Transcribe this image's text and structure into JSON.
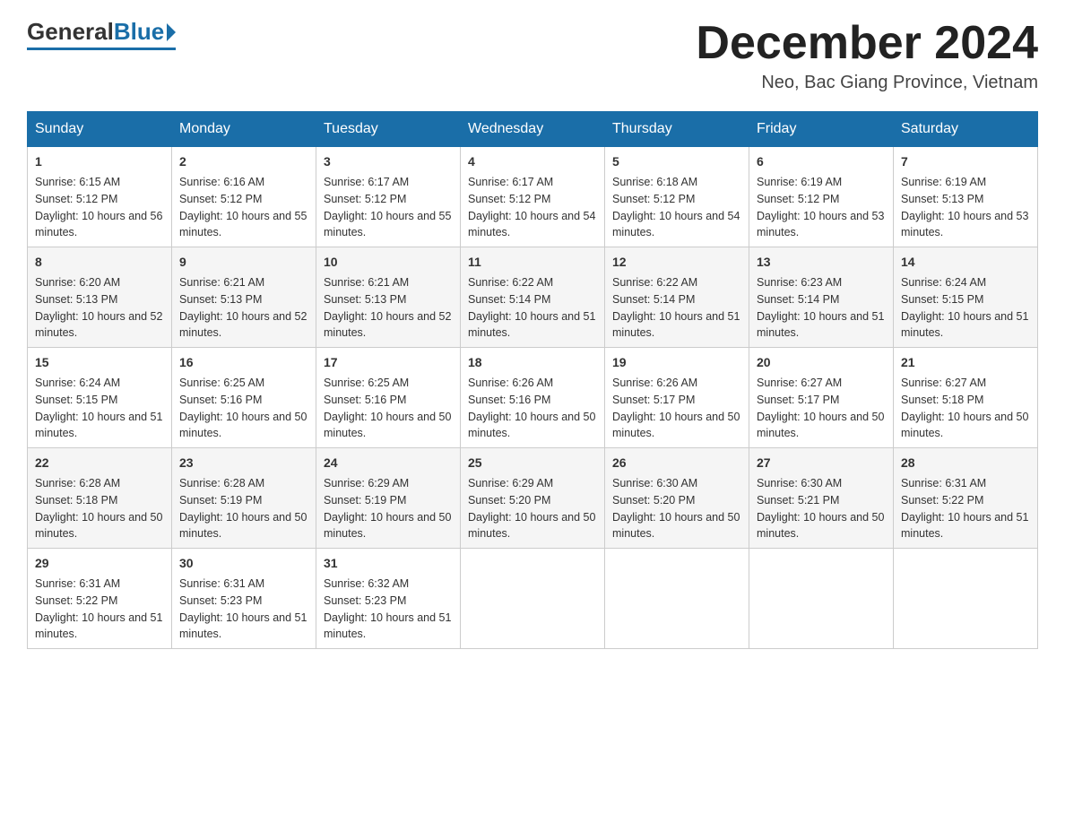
{
  "logo": {
    "general": "General",
    "blue": "Blue"
  },
  "title": {
    "month_year": "December 2024",
    "location": "Neo, Bac Giang Province, Vietnam"
  },
  "headers": [
    "Sunday",
    "Monday",
    "Tuesday",
    "Wednesday",
    "Thursday",
    "Friday",
    "Saturday"
  ],
  "weeks": [
    [
      {
        "day": "1",
        "sunrise": "Sunrise: 6:15 AM",
        "sunset": "Sunset: 5:12 PM",
        "daylight": "Daylight: 10 hours and 56 minutes."
      },
      {
        "day": "2",
        "sunrise": "Sunrise: 6:16 AM",
        "sunset": "Sunset: 5:12 PM",
        "daylight": "Daylight: 10 hours and 55 minutes."
      },
      {
        "day": "3",
        "sunrise": "Sunrise: 6:17 AM",
        "sunset": "Sunset: 5:12 PM",
        "daylight": "Daylight: 10 hours and 55 minutes."
      },
      {
        "day": "4",
        "sunrise": "Sunrise: 6:17 AM",
        "sunset": "Sunset: 5:12 PM",
        "daylight": "Daylight: 10 hours and 54 minutes."
      },
      {
        "day": "5",
        "sunrise": "Sunrise: 6:18 AM",
        "sunset": "Sunset: 5:12 PM",
        "daylight": "Daylight: 10 hours and 54 minutes."
      },
      {
        "day": "6",
        "sunrise": "Sunrise: 6:19 AM",
        "sunset": "Sunset: 5:12 PM",
        "daylight": "Daylight: 10 hours and 53 minutes."
      },
      {
        "day": "7",
        "sunrise": "Sunrise: 6:19 AM",
        "sunset": "Sunset: 5:13 PM",
        "daylight": "Daylight: 10 hours and 53 minutes."
      }
    ],
    [
      {
        "day": "8",
        "sunrise": "Sunrise: 6:20 AM",
        "sunset": "Sunset: 5:13 PM",
        "daylight": "Daylight: 10 hours and 52 minutes."
      },
      {
        "day": "9",
        "sunrise": "Sunrise: 6:21 AM",
        "sunset": "Sunset: 5:13 PM",
        "daylight": "Daylight: 10 hours and 52 minutes."
      },
      {
        "day": "10",
        "sunrise": "Sunrise: 6:21 AM",
        "sunset": "Sunset: 5:13 PM",
        "daylight": "Daylight: 10 hours and 52 minutes."
      },
      {
        "day": "11",
        "sunrise": "Sunrise: 6:22 AM",
        "sunset": "Sunset: 5:14 PM",
        "daylight": "Daylight: 10 hours and 51 minutes."
      },
      {
        "day": "12",
        "sunrise": "Sunrise: 6:22 AM",
        "sunset": "Sunset: 5:14 PM",
        "daylight": "Daylight: 10 hours and 51 minutes."
      },
      {
        "day": "13",
        "sunrise": "Sunrise: 6:23 AM",
        "sunset": "Sunset: 5:14 PM",
        "daylight": "Daylight: 10 hours and 51 minutes."
      },
      {
        "day": "14",
        "sunrise": "Sunrise: 6:24 AM",
        "sunset": "Sunset: 5:15 PM",
        "daylight": "Daylight: 10 hours and 51 minutes."
      }
    ],
    [
      {
        "day": "15",
        "sunrise": "Sunrise: 6:24 AM",
        "sunset": "Sunset: 5:15 PM",
        "daylight": "Daylight: 10 hours and 51 minutes."
      },
      {
        "day": "16",
        "sunrise": "Sunrise: 6:25 AM",
        "sunset": "Sunset: 5:16 PM",
        "daylight": "Daylight: 10 hours and 50 minutes."
      },
      {
        "day": "17",
        "sunrise": "Sunrise: 6:25 AM",
        "sunset": "Sunset: 5:16 PM",
        "daylight": "Daylight: 10 hours and 50 minutes."
      },
      {
        "day": "18",
        "sunrise": "Sunrise: 6:26 AM",
        "sunset": "Sunset: 5:16 PM",
        "daylight": "Daylight: 10 hours and 50 minutes."
      },
      {
        "day": "19",
        "sunrise": "Sunrise: 6:26 AM",
        "sunset": "Sunset: 5:17 PM",
        "daylight": "Daylight: 10 hours and 50 minutes."
      },
      {
        "day": "20",
        "sunrise": "Sunrise: 6:27 AM",
        "sunset": "Sunset: 5:17 PM",
        "daylight": "Daylight: 10 hours and 50 minutes."
      },
      {
        "day": "21",
        "sunrise": "Sunrise: 6:27 AM",
        "sunset": "Sunset: 5:18 PM",
        "daylight": "Daylight: 10 hours and 50 minutes."
      }
    ],
    [
      {
        "day": "22",
        "sunrise": "Sunrise: 6:28 AM",
        "sunset": "Sunset: 5:18 PM",
        "daylight": "Daylight: 10 hours and 50 minutes."
      },
      {
        "day": "23",
        "sunrise": "Sunrise: 6:28 AM",
        "sunset": "Sunset: 5:19 PM",
        "daylight": "Daylight: 10 hours and 50 minutes."
      },
      {
        "day": "24",
        "sunrise": "Sunrise: 6:29 AM",
        "sunset": "Sunset: 5:19 PM",
        "daylight": "Daylight: 10 hours and 50 minutes."
      },
      {
        "day": "25",
        "sunrise": "Sunrise: 6:29 AM",
        "sunset": "Sunset: 5:20 PM",
        "daylight": "Daylight: 10 hours and 50 minutes."
      },
      {
        "day": "26",
        "sunrise": "Sunrise: 6:30 AM",
        "sunset": "Sunset: 5:20 PM",
        "daylight": "Daylight: 10 hours and 50 minutes."
      },
      {
        "day": "27",
        "sunrise": "Sunrise: 6:30 AM",
        "sunset": "Sunset: 5:21 PM",
        "daylight": "Daylight: 10 hours and 50 minutes."
      },
      {
        "day": "28",
        "sunrise": "Sunrise: 6:31 AM",
        "sunset": "Sunset: 5:22 PM",
        "daylight": "Daylight: 10 hours and 51 minutes."
      }
    ],
    [
      {
        "day": "29",
        "sunrise": "Sunrise: 6:31 AM",
        "sunset": "Sunset: 5:22 PM",
        "daylight": "Daylight: 10 hours and 51 minutes."
      },
      {
        "day": "30",
        "sunrise": "Sunrise: 6:31 AM",
        "sunset": "Sunset: 5:23 PM",
        "daylight": "Daylight: 10 hours and 51 minutes."
      },
      {
        "day": "31",
        "sunrise": "Sunrise: 6:32 AM",
        "sunset": "Sunset: 5:23 PM",
        "daylight": "Daylight: 10 hours and 51 minutes."
      },
      null,
      null,
      null,
      null
    ]
  ]
}
